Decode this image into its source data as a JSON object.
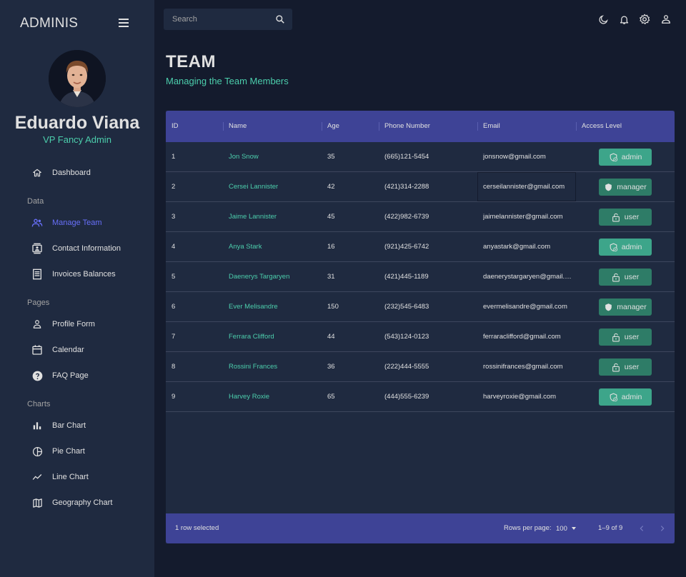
{
  "brand": "ADMINIS",
  "profile": {
    "name": "Eduardo Viana",
    "role": "VP Fancy Admin"
  },
  "nav": {
    "dashboard": {
      "label": "Dashboard",
      "icon": "home-icon"
    },
    "sections": {
      "data": "Data",
      "pages": "Pages",
      "charts": "Charts"
    },
    "data_items": [
      {
        "label": "Manage Team",
        "icon": "people-icon",
        "active": true
      },
      {
        "label": "Contact Information",
        "icon": "contacts-icon"
      },
      {
        "label": "Invoices Balances",
        "icon": "receipt-icon"
      }
    ],
    "page_items": [
      {
        "label": "Profile Form",
        "icon": "person-icon"
      },
      {
        "label": "Calendar",
        "icon": "calendar-icon"
      },
      {
        "label": "FAQ Page",
        "icon": "help-icon"
      }
    ],
    "chart_items": [
      {
        "label": "Bar Chart",
        "icon": "bar-chart-icon"
      },
      {
        "label": "Pie Chart",
        "icon": "pie-chart-icon"
      },
      {
        "label": "Line Chart",
        "icon": "line-chart-icon"
      },
      {
        "label": "Geography Chart",
        "icon": "map-icon"
      }
    ]
  },
  "search": {
    "placeholder": "Search"
  },
  "header": {
    "title": "TEAM",
    "subtitle": "Managing the Team Members"
  },
  "table": {
    "columns": [
      "ID",
      "Name",
      "Age",
      "Phone Number",
      "Email",
      "Access Level"
    ],
    "rows": [
      {
        "id": "1",
        "name": "Jon Snow",
        "age": "35",
        "phone": "(665)121-5454",
        "email": "jonsnow@gmail.com",
        "access": "admin"
      },
      {
        "id": "2",
        "name": "Cersei Lannister",
        "age": "42",
        "phone": "(421)314-2288",
        "email": "cerseilannister@gmail.com",
        "access": "manager"
      },
      {
        "id": "3",
        "name": "Jaime Lannister",
        "age": "45",
        "phone": "(422)982-6739",
        "email": "jaimelannister@gmail.com",
        "access": "user"
      },
      {
        "id": "4",
        "name": "Anya Stark",
        "age": "16",
        "phone": "(921)425-6742",
        "email": "anyastark@gmail.com",
        "access": "admin"
      },
      {
        "id": "5",
        "name": "Daenerys Targaryen",
        "age": "31",
        "phone": "(421)445-1189",
        "email": "daenerystargaryen@gmail.c...",
        "access": "user"
      },
      {
        "id": "6",
        "name": "Ever Melisandre",
        "age": "150",
        "phone": "(232)545-6483",
        "email": "evermelisandre@gmail.com",
        "access": "manager"
      },
      {
        "id": "7",
        "name": "Ferrara Clifford",
        "age": "44",
        "phone": "(543)124-0123",
        "email": "ferraraclifford@gmail.com",
        "access": "user"
      },
      {
        "id": "8",
        "name": "Rossini Frances",
        "age": "36",
        "phone": "(222)444-5555",
        "email": "rossinifrances@gmail.com",
        "access": "user"
      },
      {
        "id": "9",
        "name": "Harvey Roxie",
        "age": "65",
        "phone": "(444)555-6239",
        "email": "harveyroxie@gmail.com",
        "access": "admin"
      }
    ],
    "footer": {
      "selection": "1 row selected",
      "rows_per_page_label": "Rows per page:",
      "rows_per_page": "100",
      "range": "1–9 of 9"
    }
  },
  "colors": {
    "background": "#141b2d",
    "sidebar": "#1f2a40",
    "accent_green": "#4cceac",
    "accent_blue": "#6870fa",
    "header_blue": "#3e4396",
    "badge_admin": "#3da58a",
    "badge_other": "#2e7c67"
  }
}
